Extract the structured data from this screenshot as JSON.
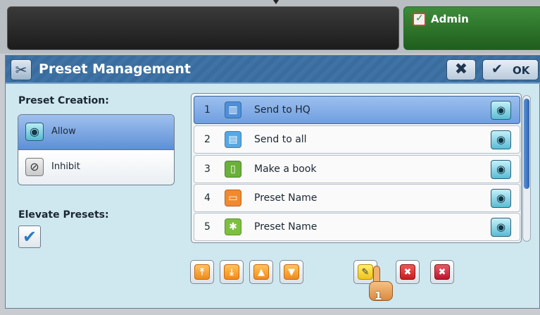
{
  "topbar": {
    "admin_label": "Admin"
  },
  "dialog": {
    "title": "Preset Management",
    "close_label": "✖",
    "ok_label": "OK"
  },
  "preset_creation": {
    "label": "Preset Creation:",
    "options": [
      {
        "label": "Allow",
        "selected": true,
        "icon": "eye-icon"
      },
      {
        "label": "Inhibit",
        "selected": false,
        "icon": "eye-slash-icon"
      }
    ]
  },
  "elevate_presets": {
    "label": "Elevate Presets:",
    "checked": true
  },
  "presets": [
    {
      "num": "1",
      "name": "Send to HQ",
      "icon": "bank-icon",
      "selected": true
    },
    {
      "num": "2",
      "name": "Send to all",
      "icon": "clipboard-icon",
      "selected": false
    },
    {
      "num": "3",
      "name": "Make a book",
      "icon": "book-icon",
      "selected": false
    },
    {
      "num": "4",
      "name": "Preset Name",
      "icon": "briefcase-icon",
      "selected": false
    },
    {
      "num": "5",
      "name": "Preset Name",
      "icon": "gear-icon",
      "selected": false
    }
  ],
  "actions": [
    {
      "name": "move-to-top",
      "icon": "arrow-top-icon",
      "color": "#f08a1c"
    },
    {
      "name": "move-to-bottom",
      "icon": "arrow-bottom-icon",
      "color": "#f08a1c"
    },
    {
      "name": "move-up",
      "icon": "arrow-up-icon",
      "color": "#f08a1c"
    },
    {
      "name": "move-down",
      "icon": "arrow-down-icon",
      "color": "#f08a1c"
    },
    {
      "name": "edit",
      "icon": "pencil-icon",
      "color": "#f0c21a"
    },
    {
      "name": "delete",
      "icon": "x-icon",
      "color": "#c41e1e"
    },
    {
      "name": "delete-all",
      "icon": "multi-x-icon",
      "color": "#b8172a"
    }
  ],
  "cursor": {
    "badge": "1"
  },
  "colors": {
    "titlebar": "#3f73a6",
    "admin": "#2f7a2c",
    "selected": "#6f9ee0",
    "dialog_bg": "#cfe8f0"
  }
}
